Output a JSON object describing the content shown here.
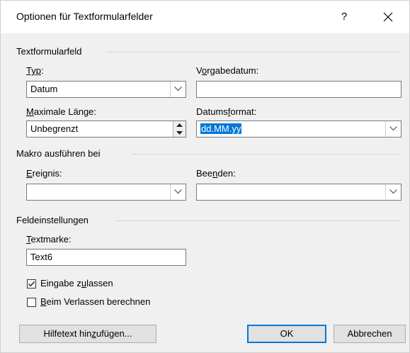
{
  "dialog": {
    "title": "Optionen für Textformularfelder",
    "help_glyph": "?",
    "close_glyph": "✕"
  },
  "textfield_group": {
    "label": "Textformularfeld",
    "type": {
      "label_u": "Typ",
      "label_rest": ":",
      "value": "Datum"
    },
    "default_date": {
      "label_pre": "V",
      "label_u": "o",
      "label_rest": "rgabedatum:",
      "value": ""
    },
    "max_length": {
      "label_u": "M",
      "label_rest": "aximale Länge:",
      "value": "Unbegrenzt"
    },
    "date_format": {
      "label_pre": "Datums",
      "label_u": "f",
      "label_rest": "ormat:",
      "value": "dd.MM.yy"
    }
  },
  "macro_group": {
    "label": "Makro ausführen bei",
    "entry": {
      "label_u": "E",
      "label_rest": "reignis:",
      "value": ""
    },
    "exit": {
      "label_pre": "Bee",
      "label_u": "n",
      "label_rest": "den:",
      "value": ""
    }
  },
  "field_settings_group": {
    "label": "Feldeinstellungen",
    "bookmark": {
      "label_u": "T",
      "label_rest": "extmarke:",
      "value": "Text6"
    },
    "allow_input": {
      "label_pre": "Eingabe z",
      "label_u": "u",
      "label_rest": "lassen",
      "checked": true
    },
    "calc_on_exit": {
      "label_u": "B",
      "label_rest": "eim Verlassen berechnen",
      "checked": false
    }
  },
  "buttons": {
    "help_text": {
      "label_pre": "Hilfetext hin",
      "label_u": "z",
      "label_rest": "ufügen..."
    },
    "ok": "OK",
    "cancel": "Abbrechen"
  }
}
